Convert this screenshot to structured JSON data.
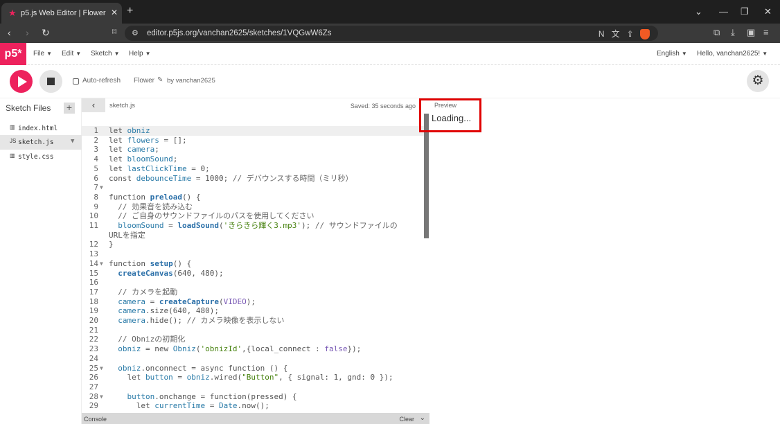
{
  "browser": {
    "tab_title": "p5.js Web Editor | Flower",
    "tab_close": "✕",
    "new_tab": "+",
    "url": "editor.p5js.org/vanchan2625/sketches/1VQGwW6Zs"
  },
  "menus": [
    "File",
    "Edit",
    "Sketch",
    "Help"
  ],
  "header": {
    "logo": "p5*",
    "language": "English",
    "user": "Hello, vanchan2625!"
  },
  "toolbar": {
    "auto_refresh": "Auto-refresh",
    "sketch_name": "Flower",
    "by_line": "by vanchan2625"
  },
  "sidebar": {
    "title": "Sketch Files",
    "files": [
      {
        "name": "index.html",
        "selected": false
      },
      {
        "name": "sketch.js",
        "selected": true
      },
      {
        "name": "style.css",
        "selected": false
      }
    ]
  },
  "editor": {
    "tab": "sketch.js",
    "saved_status": "Saved: 35 seconds ago",
    "line_numbers": [
      "1",
      "2",
      "3",
      "4",
      "5",
      "6",
      "7",
      "8",
      "9",
      "10",
      "11",
      "",
      "12",
      "13",
      "14",
      "15",
      "16",
      "17",
      "18",
      "19",
      "20",
      "21",
      "22",
      "23",
      "24",
      "25",
      "26",
      "27",
      "28",
      "29"
    ],
    "code_lines": [
      "let obniz",
      "let flowers = [];",
      "let camera;",
      "let bloomSound;",
      "let lastClickTime = 0;",
      "const debounceTime = 1000; // デバウンスする時間（ミリ秒）",
      "",
      "function preload() {",
      "  // 効果音を読み込む",
      "  // ご自身のサウンドファイルのパスを使用してください",
      "  bloomSound = loadSound('きらきら輝く3.mp3'); // サウンドファイルの",
      "URLを指定",
      "}",
      "",
      "function setup() {",
      "  createCanvas(640, 480);",
      "",
      "  // カメラを起動",
      "  camera = createCapture(VIDEO);",
      "  camera.size(640, 480);",
      "  camera.hide(); // カメラ映像を表示しない",
      "",
      "  // Obnizの初期化",
      "  obniz = new Obniz('obnizId',{local_connect : false});",
      "",
      "  obniz.onconnect = async function () {",
      "    let button = obniz.wired(\"Button\", { signal: 1, gnd: 0 });",
      "",
      "    button.onchange = function(pressed) {",
      "      let currentTime = Date.now();"
    ]
  },
  "console": {
    "label": "Console",
    "clear": "Clear"
  },
  "preview": {
    "label": "Preview",
    "loading": "Loading..."
  },
  "colors": {
    "accent": "#ED225D",
    "highlight_box": "#E00000"
  }
}
